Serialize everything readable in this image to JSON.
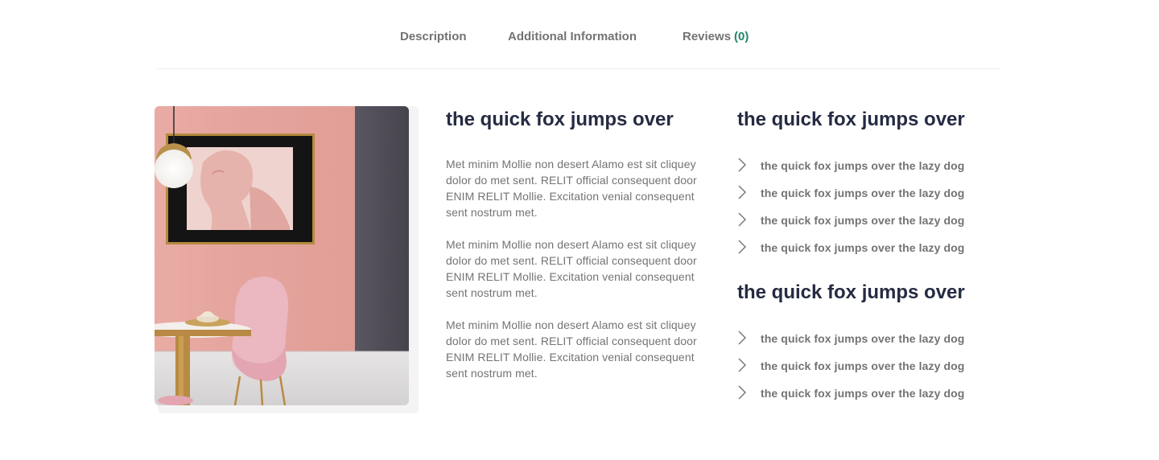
{
  "tabs": [
    {
      "label": "Description"
    },
    {
      "label": "Additional Information"
    },
    {
      "label": "Reviews",
      "count": "(0)"
    }
  ],
  "colors": {
    "accent": "#23856D",
    "heading": "#252B42",
    "body": "#737373",
    "divider": "#ECECEC"
  },
  "image": {
    "alt": "pink dining room interior"
  },
  "middle": {
    "title": "the quick fox jumps over",
    "paragraphs": [
      "Met minim Mollie non desert Alamo est sit cliquey dolor do met sent. RELIT official consequent door ENIM RELIT Mollie. Excitation venial consequent sent nostrum met.",
      "Met minim Mollie non desert Alamo est sit cliquey dolor do met sent. RELIT official consequent door ENIM RELIT Mollie. Excitation venial consequent sent nostrum met.",
      "Met minim Mollie non desert Alamo est sit cliquey dolor do met sent. RELIT official consequent door ENIM RELIT Mollie. Excitation venial consequent sent nostrum met."
    ]
  },
  "right": {
    "sections": [
      {
        "title": "the quick fox jumps over",
        "items": [
          "the quick fox jumps over the lazy dog",
          "the quick fox jumps over the lazy dog",
          "the quick fox jumps over the lazy dog",
          "the quick fox jumps over the lazy dog"
        ]
      },
      {
        "title": "the quick fox jumps over",
        "items": [
          "the quick fox jumps over the lazy dog",
          "the quick fox jumps over the lazy dog",
          "the quick fox jumps over the lazy dog"
        ]
      }
    ],
    "item_icon": "chevron-right-icon"
  }
}
